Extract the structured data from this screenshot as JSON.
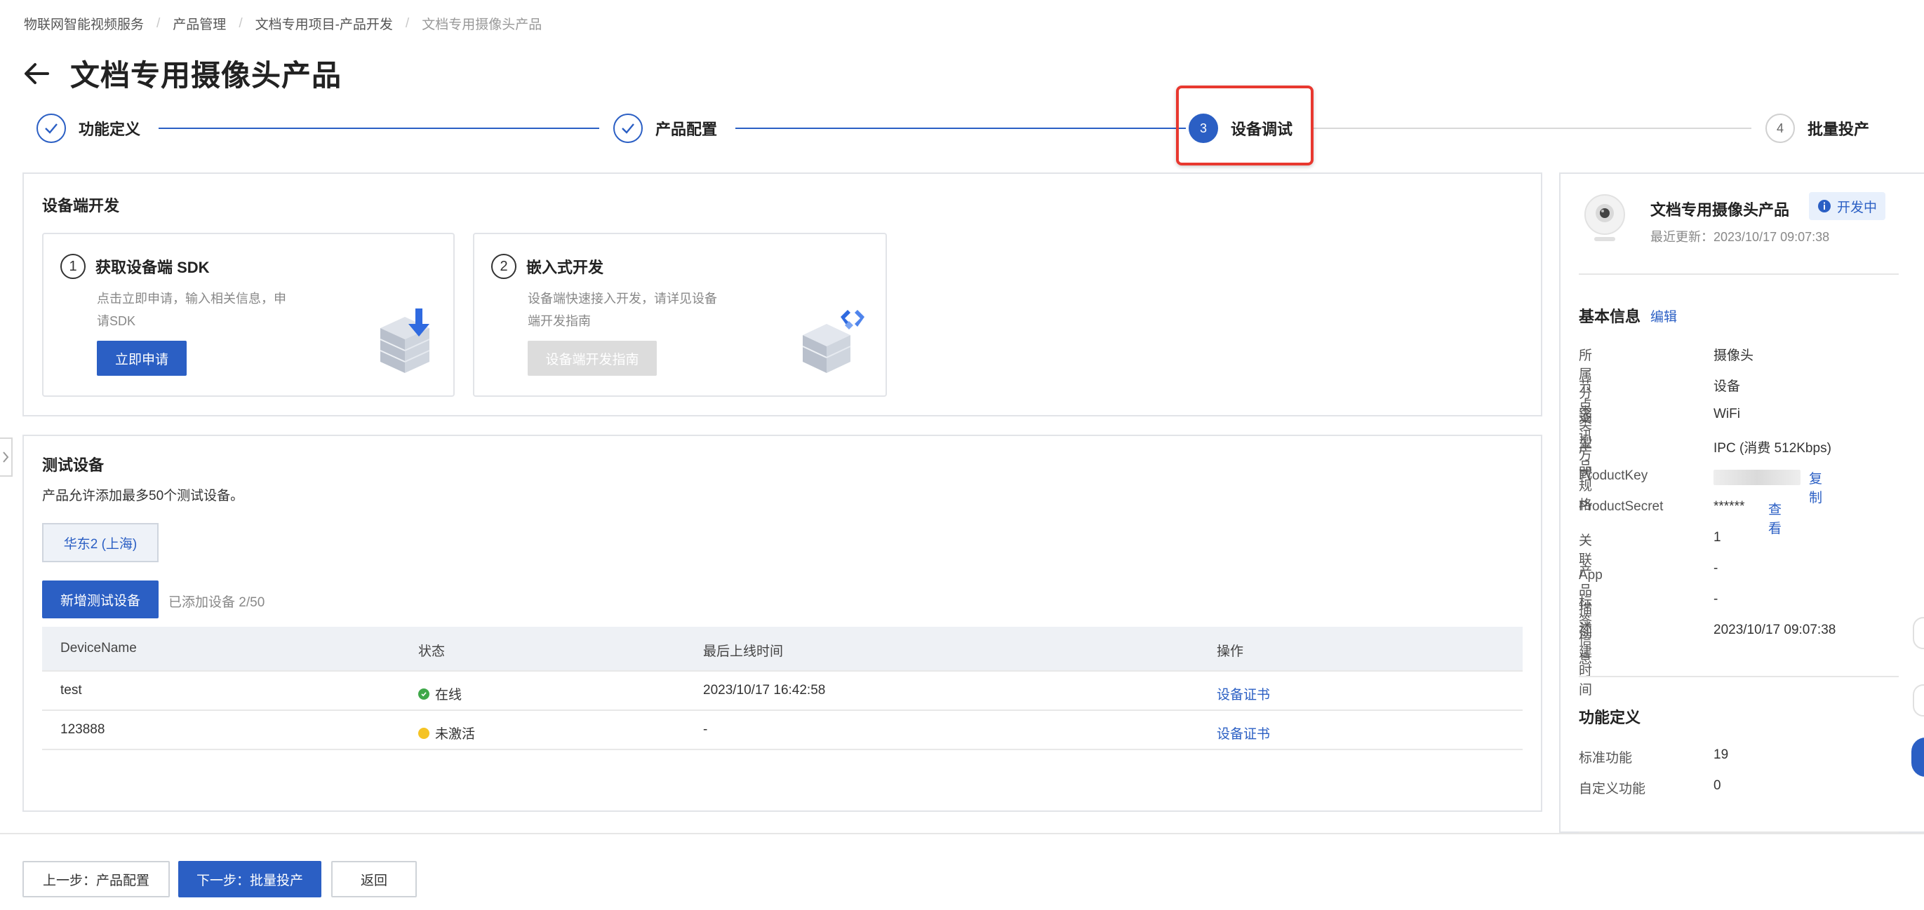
{
  "breadcrumb": [
    "物联网智能视频服务",
    "产品管理",
    "文档专用项目-产品开发",
    "文档专用摄像头产品"
  ],
  "page_title": "文档专用摄像头产品",
  "steps": [
    {
      "num": "1",
      "label": "功能定义",
      "state": "done"
    },
    {
      "num": "2",
      "label": "产品配置",
      "state": "done"
    },
    {
      "num": "3",
      "label": "设备调试",
      "state": "active"
    },
    {
      "num": "4",
      "label": "批量投产",
      "state": "todo"
    }
  ],
  "device_dev": {
    "title": "设备端开发",
    "cards": [
      {
        "num": "1",
        "title": "获取设备端 SDK",
        "desc_line1": "点击立即申请，输入相关信息，申",
        "desc_line2": "请SDK",
        "button": "立即申请",
        "icon": "sdk-download-icon"
      },
      {
        "num": "2",
        "title": "嵌入式开发",
        "desc_line1": "设备端快速接入开发，请详见设备",
        "desc_line2": "端开发指南",
        "button": "设备端开发指南",
        "icon": "embedded-code-icon"
      }
    ]
  },
  "test_devices": {
    "title": "测试设备",
    "subtitle": "产品允许添加最多50个测试设备。",
    "region": "华东2 (上海)",
    "add_button": "新增测试设备",
    "added_count": "已添加设备 2/50",
    "columns": [
      "DeviceName",
      "状态",
      "最后上线时间",
      "操作"
    ],
    "rows": [
      {
        "name": "test",
        "status": "在线",
        "status_color": "#3fa84a",
        "last_online": "2023/10/17 16:42:58",
        "action": "设备证书"
      },
      {
        "name": "123888",
        "status": "未激活",
        "status_color": "#f5c324",
        "last_online": "-",
        "action": "设备证书"
      }
    ]
  },
  "product_panel": {
    "name": "文档专用摄像头产品",
    "status_badge": "开发中",
    "updated": "最近更新：2023/10/17 09:07:38",
    "basic_title": "基本信息",
    "edit": "编辑",
    "fields": [
      {
        "label": "所属分类",
        "value": "摄像头"
      },
      {
        "label": "节点类型",
        "value": "设备"
      },
      {
        "label": "通讯方式",
        "value": "WiFi"
      },
      {
        "label": "产品规格",
        "value": "IPC (消费 512Kbps)"
      },
      {
        "label": "ProductKey",
        "value": "",
        "action": "复制"
      },
      {
        "label": "ProductSecret",
        "value": "******",
        "action": "查看"
      },
      {
        "label": "关联 App",
        "value": "1"
      },
      {
        "label": "产品描述",
        "value": "-"
      },
      {
        "label": "标签信息",
        "value": "-"
      },
      {
        "label": "创建时间",
        "value": "2023/10/17 09:07:38"
      }
    ],
    "func_title": "功能定义",
    "func_fields": [
      {
        "label": "标准功能",
        "value": "19"
      },
      {
        "label": "自定义功能",
        "value": "0"
      }
    ]
  },
  "footer": {
    "prev": "上一步：产品配置",
    "next": "下一步：批量投产",
    "back": "返回"
  },
  "colors": {
    "primary": "#2b5fc4",
    "highlight": "#e8382f"
  }
}
